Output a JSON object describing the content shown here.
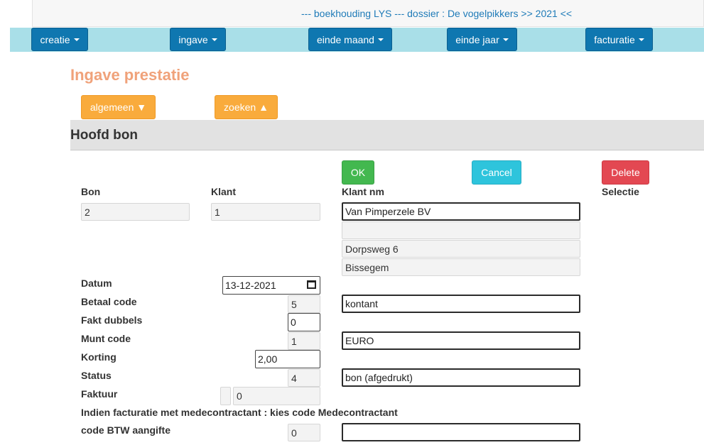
{
  "header": {
    "title": "--- boekhouding LYS --- dossier : De vogelpikkers >> 2021 <<"
  },
  "nav": {
    "creatie": "creatie",
    "ingave": "ingave",
    "einde_maand": "einde maand",
    "einde_jaar": "einde jaar",
    "facturatie": "facturatie"
  },
  "page": {
    "title": "Ingave prestatie"
  },
  "toggles": {
    "algemeen": "algemeen ▼",
    "zoeken": "zoeken ▲"
  },
  "section": {
    "title": "Hoofd bon"
  },
  "actions": {
    "ok": "OK",
    "cancel": "Cancel",
    "delete": "Delete"
  },
  "labels": {
    "bon": "Bon",
    "klant": "Klant",
    "klant_nm": "Klant nm",
    "selectie": "Selectie",
    "datum": "Datum",
    "betaal_code": "Betaal code",
    "fakt_dubbels": "Fakt dubbels",
    "munt_code": "Munt code",
    "korting": "Korting",
    "status": "Status",
    "faktuur": "Faktuur",
    "medecontractant": "Indien facturatie met medecontractant : kies code Medecontractant",
    "code_btw": "code BTW aangifte"
  },
  "values": {
    "bon": "2",
    "klant": "1",
    "klant_nm": "Van Pimperzele BV",
    "klant_line2": "",
    "adres": "Dorpsweg 6",
    "gemeente": "Bissegem",
    "datum": "13-12-2021",
    "betaal_code": "5",
    "betaal_desc": "kontant",
    "fakt_dubbels": "0",
    "munt_code": "1",
    "munt_desc": "EURO",
    "korting": "2,00",
    "status": "4",
    "status_desc": "bon (afgedrukt)",
    "faktuur": "0",
    "code_btw": "0",
    "code_btw_desc": ""
  },
  "colors": {
    "nav_button": "#0f77b0",
    "nav_bar": "#a9dfe8",
    "title": "#f0a27a",
    "orange": "#f9ab3c",
    "ok": "#43b84f",
    "cancel": "#2ec4dc",
    "delete": "#e34852"
  }
}
